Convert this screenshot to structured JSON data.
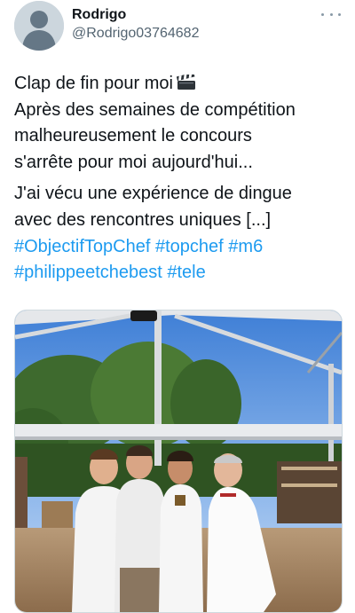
{
  "tweet": {
    "author": {
      "display_name": "Rodrigo",
      "handle": "@Rodrigo03764682",
      "avatar_icon": "default-avatar-icon"
    },
    "more_icon": "more-horizontal-icon",
    "lines": [
      "Clap de fin pour moi",
      "Après des semaines de compétition",
      "malheureusement le concours",
      "s'arrête pour moi aujourd'hui...",
      "J'ai vécu une expérience de dingue",
      "avec des rencontres uniques [...]"
    ],
    "emoji_icon": "clapperboard-icon",
    "hashtags": [
      "#ObjectifTopChef",
      "#topchef",
      "#m6",
      "#philippeetchebest",
      "#tele"
    ],
    "media_icon": "photo-chefs-tent"
  },
  "colors": {
    "text": "#0f1419",
    "secondary": "#536471",
    "link": "#1d9bf0",
    "avatar_bg": "#ccd6dd"
  }
}
